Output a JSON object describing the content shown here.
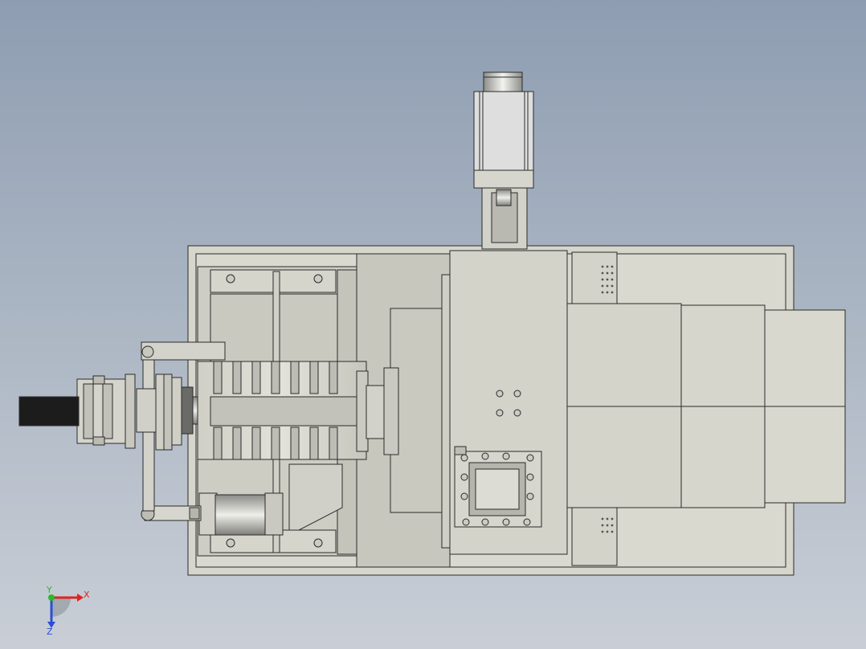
{
  "view": {
    "background_top": "#8e9db2",
    "background_bottom": "#c9ced6",
    "part_color": "#d9d9cf",
    "edge_color": "#2b2b2b"
  },
  "triad": {
    "x_label": "X",
    "y_label": "Y",
    "z_label": "Z",
    "x_color": "#e0231f",
    "y_color": "#2db82d",
    "z_color": "#2a4fd6"
  }
}
